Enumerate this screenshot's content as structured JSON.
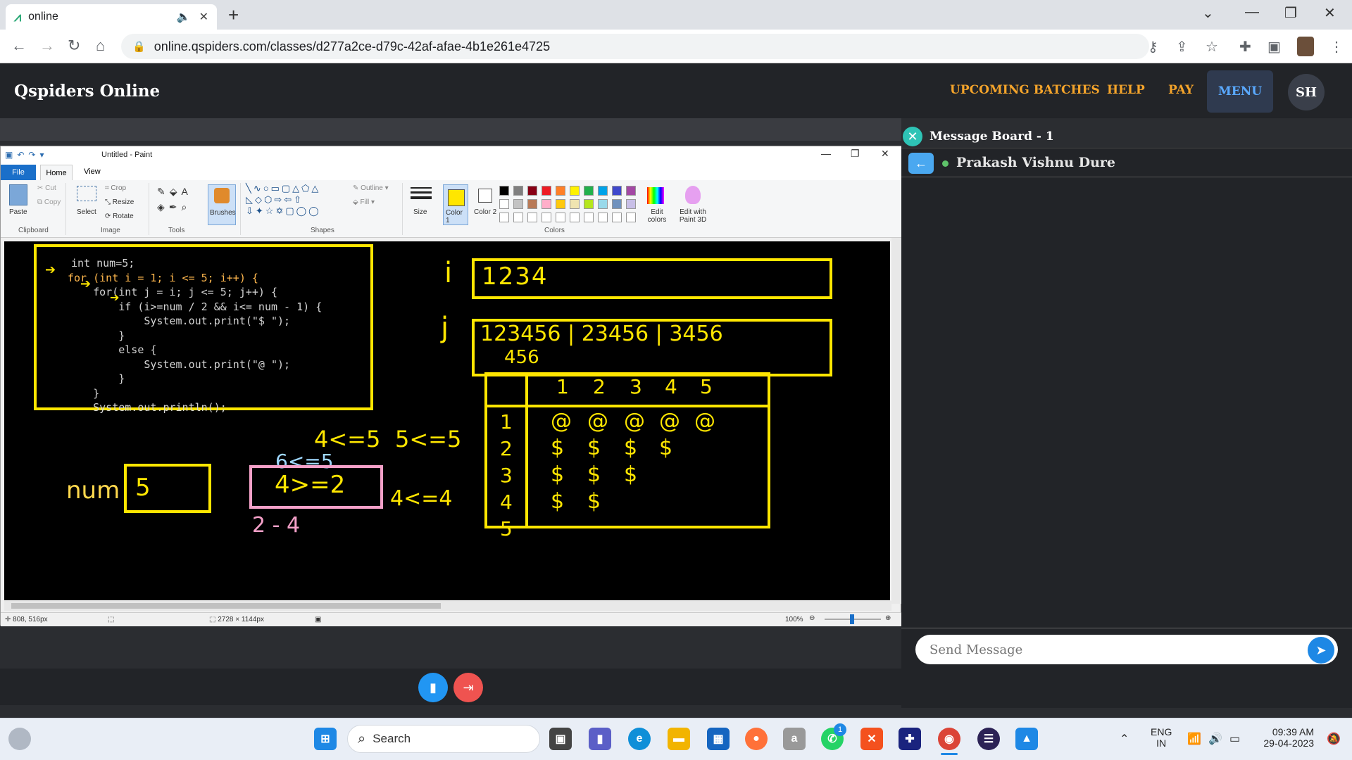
{
  "browser": {
    "tab_title": "online",
    "url": "online.qspiders.com/classes/d277a2ce-d79c-42af-afae-4b1e261e4725"
  },
  "site": {
    "brand": "Qspiders Online",
    "nav": [
      "UPCOMING BATCHES",
      "HELP",
      "PAY",
      "MENU"
    ],
    "avatar": "SH"
  },
  "paint": {
    "title": "Untitled - Paint",
    "tabs": [
      "File",
      "Home",
      "View"
    ],
    "clipboard": {
      "paste": "Paste",
      "cut": "Cut",
      "copy": "Copy",
      "group": "Clipboard"
    },
    "image": {
      "select": "Select",
      "crop": "Crop",
      "resize": "Resize",
      "rotate": "Rotate",
      "group": "Image"
    },
    "tools_group": "Tools",
    "brushes": "Brushes",
    "shapes": {
      "outline": "Outline",
      "fill": "Fill",
      "group": "Shapes"
    },
    "size": "Size",
    "color1": "Color 1",
    "color2": "Color 2",
    "edit_colors": "Edit colors",
    "edit_paint3d": "Edit with Paint 3D",
    "colors_group": "Colors",
    "status": {
      "cursor": "808, 516px",
      "dimensions": "2728 × 1144px",
      "zoom": "100%"
    }
  },
  "canvas": {
    "code_lines": [
      "int num=5;",
      "for (int i = 1; i <= 5; i++) {",
      "    for(int j = i; j <= 5; j++) {",
      "        if (i>=num / 2 && i<= num - 1) {",
      "            System.out.print(\"$ \");",
      "        }",
      "        else {",
      "            System.out.print(\"@ \");",
      "        }",
      "    }",
      "    System.out.println();"
    ],
    "i_label": "i",
    "i_values": "1234",
    "j_label": "j",
    "j_values": "123456 | 23456 | 3456",
    "j_values2": "456",
    "note1": "4<=5",
    "note2": "5<=5",
    "note3": "6<=5",
    "num_label": "num",
    "num_value": "5",
    "cond": "4>=2",
    "range": "2 - 4",
    "note4": "4<=4",
    "table_cols": [
      "1",
      "2",
      "3",
      "4",
      "5"
    ],
    "table_rows": [
      {
        "row": "1",
        "cells": [
          "@",
          "@",
          "@",
          "@",
          "@"
        ]
      },
      {
        "row": "2",
        "cells": [
          "$",
          "$",
          "$",
          "$"
        ]
      },
      {
        "row": "3",
        "cells": [
          "$",
          "$",
          "$"
        ]
      },
      {
        "row": "4",
        "cells": [
          "$",
          "$"
        ]
      },
      {
        "row": "5",
        "cells": []
      }
    ]
  },
  "message_board": {
    "title": "Message Board - 1",
    "user": "Prakash Vishnu Dure",
    "placeholder": "Send Message"
  },
  "taskbar": {
    "search": "Search",
    "lang1": "ENG",
    "lang2": "IN",
    "time": "09:39 AM",
    "date": "29-04-2023",
    "whatsapp_badge": "1"
  },
  "colors": {
    "accent_orange": "#f4a42b",
    "accent_blue": "#5aa9ff",
    "annotation_yellow": "#ffe600",
    "annotation_pink": "#f4a0c8"
  }
}
